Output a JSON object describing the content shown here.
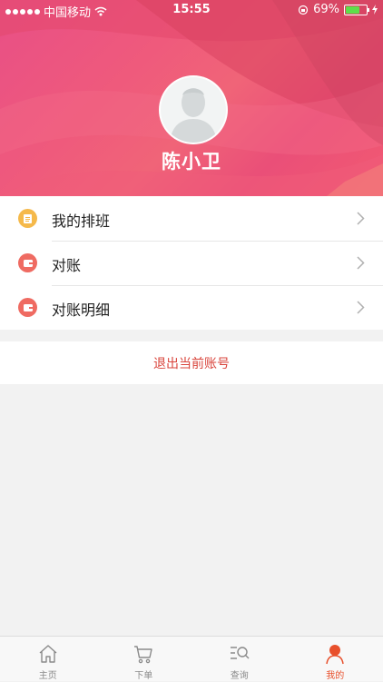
{
  "status_bar": {
    "carrier": "中国移动",
    "time": "15:55",
    "battery_percent": "69%",
    "battery_level": 0.69
  },
  "profile": {
    "username": "陈小卫"
  },
  "menu": {
    "items": [
      {
        "label": "我的排班",
        "icon": "schedule-icon",
        "icon_color": "#f5b94a"
      },
      {
        "label": "对账",
        "icon": "wallet-icon",
        "icon_color": "#ef6b62"
      },
      {
        "label": "对账明细",
        "icon": "wallet-detail-icon",
        "icon_color": "#ef6b62"
      }
    ]
  },
  "logout": {
    "label": "退出当前账号",
    "color": "#d9453c"
  },
  "tabbar": {
    "tabs": [
      {
        "label": "主页",
        "icon": "home-icon",
        "active": false
      },
      {
        "label": "下单",
        "icon": "cart-icon",
        "active": false
      },
      {
        "label": "查询",
        "icon": "search-list-icon",
        "active": false
      },
      {
        "label": "我的",
        "icon": "user-icon",
        "active": true
      }
    ],
    "active_color": "#e8502c"
  }
}
